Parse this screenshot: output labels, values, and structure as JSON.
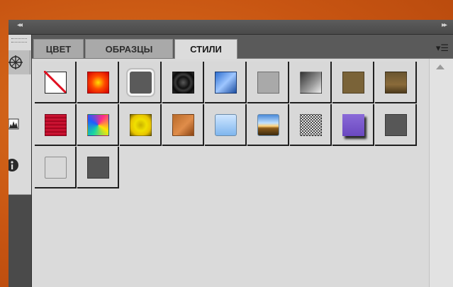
{
  "panel": {
    "collapse_left_label": "◂◂",
    "collapse_right_label": "▸▸",
    "menu_label": "▾☰"
  },
  "tabs": [
    {
      "label": "ЦВЕТ",
      "active": false
    },
    {
      "label": "ОБРАЗЦЫ",
      "active": false
    },
    {
      "label": "СТИЛИ",
      "active": true
    }
  ],
  "dock_tools": [
    {
      "icon": "compass-icon",
      "active": true
    },
    {
      "icon": "histogram-icon",
      "active": false
    },
    {
      "icon": "info-circle-icon",
      "active": false
    }
  ],
  "styles": [
    {
      "name": "no-style",
      "fill": "#ffffff"
    },
    {
      "name": "red-glow",
      "fill": "radial-gradient(circle, #ffde00 0%, #ff4a00 45%, #d40000 100%)"
    },
    {
      "name": "gray-outer-glow",
      "fill": "#5a5a5a"
    },
    {
      "name": "black-ring",
      "fill": "radial-gradient(circle, #5a5a5a 0%, #111 40%, #3a3a3a 55%, #0b0b0b 75%, #2c2c2c 100%)"
    },
    {
      "name": "blue-bevel",
      "fill": "linear-gradient(135deg, #2f6fd0 0%, #9ec6ff 50%, #1d4ea0 100%)"
    },
    {
      "name": "light-gray",
      "fill": "#a9a9a9"
    },
    {
      "name": "dark-gray-gradient",
      "fill": "linear-gradient(135deg, #333 0%, #9a9a9a 60%, #ededed 100%)"
    },
    {
      "name": "olive-brown",
      "fill": "#7a6338"
    },
    {
      "name": "bronze",
      "fill": "linear-gradient(#6a5530, #8a6b3a 60%, #4d3a1c)"
    },
    {
      "name": "red-grid",
      "fill": "repeating-linear-gradient(0deg, #b0001e 0px, #d41a3a 3px, #8a0016 5px)"
    },
    {
      "name": "psychedelic",
      "fill": "conic-gradient(from 30deg, #ff2b8a, #ffe600, #18d6a2, #1e5cff, #ff2b8a)"
    },
    {
      "name": "yellow-gold",
      "fill": "radial-gradient(circle, #c9b200 0%, #f0e000 40%, #e8c400 70%, #7a6400 100%)"
    },
    {
      "name": "copper",
      "fill": "linear-gradient(135deg, #b86a2a 0%, #e08d4a 55%, #8a4414 100%)"
    },
    {
      "name": "light-blue",
      "fill": "linear-gradient(#cfe6ff, #7fb6ee)"
    },
    {
      "name": "landscape",
      "fill": "linear-gradient(#4a8ad8 0%, #bfe0ff 40%, #ffd27a 55%, #8a5a1a 65%, #3a2a10 100%)"
    },
    {
      "name": "noise-texture",
      "fill": "repeating-conic-gradient(#e6e6e6 0 25%, #4a4a4a 0 50%) 0 0 / 4px 4px"
    },
    {
      "name": "purple-drop-shadow",
      "fill": "linear-gradient(#8a6ad8, #6a48c0)"
    },
    {
      "name": "dark-gray",
      "fill": "#575757"
    },
    {
      "name": "empty-outline",
      "fill": "#d8d8d8"
    },
    {
      "name": "dark-gray-2",
      "fill": "#555555"
    }
  ]
}
